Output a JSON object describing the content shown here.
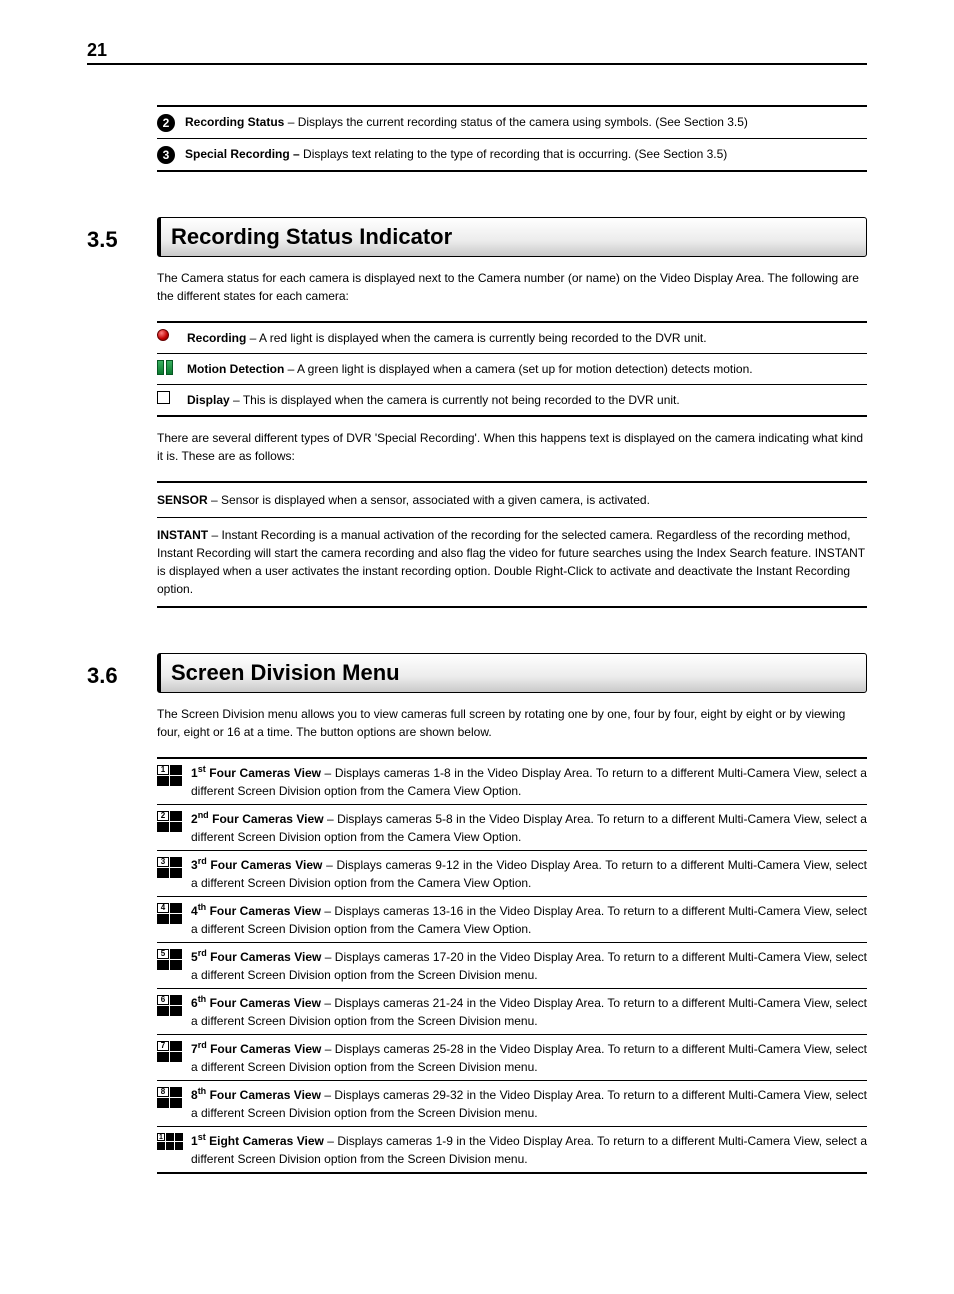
{
  "page_number": "21",
  "callouts": [
    {
      "num": "2",
      "title": "Recording Status",
      "rest": " – Displays the current recording status of the camera using symbols. (See Section 3.5)"
    },
    {
      "num": "3",
      "title": "Special Recording –",
      "rest": " Displays text relating to the type of recording that is occurring. (See Section 3.5)"
    }
  ],
  "sec35": {
    "num": "3.5",
    "title": "Recording Status Indicator",
    "intro": "The Camera status for each camera is displayed next to the Camera number (or name) on the Video Display Area. The following are the different states for each camera:",
    "statuses": [
      {
        "icon": "red-dot",
        "title": "Recording",
        "rest": " – A red light is displayed when the camera is currently being recorded to the DVR unit."
      },
      {
        "icon": "green-bars",
        "title": "Motion Detection",
        "rest": " – A green light is displayed when a camera (set up for motion detection) detects motion."
      },
      {
        "icon": "empty-sq",
        "title": "Display",
        "rest": " – This is displayed when the camera is currently not being recorded to the DVR unit."
      }
    ],
    "special_intro": "There are several different types of DVR 'Special Recording'. When this happens text is displayed on the camera indicating what kind it is. These are as follows:",
    "specials": [
      {
        "title": "SENSOR",
        "rest": " – Sensor is displayed when a sensor, associated with a given camera, is activated."
      },
      {
        "title": "INSTANT",
        "rest": " – Instant Recording is a manual activation of the recording for the selected camera. Regardless of the recording method, Instant Recording will start the camera recording and also flag the video for future searches using the Index Search feature. INSTANT is displayed when a user activates the instant recording option. Double Right-Click to activate and deactivate the Instant Recording option."
      }
    ]
  },
  "sec36": {
    "num": "3.6",
    "title": "Screen Division Menu",
    "intro": "The Screen Division menu allows you to view cameras full screen by rotating one by one, four by four, eight by eight or by viewing four, eight or 16 at a time. The button options are shown below.",
    "views": [
      {
        "iconType": "g4",
        "iconNum": "1",
        "ord": "1",
        "sup": "st",
        "name": " Four Cameras View",
        "rest": " – Displays cameras 1-8 in the Video Display Area. To return to a different Multi-Camera View, select a different Screen Division option from the Camera View Option."
      },
      {
        "iconType": "g4",
        "iconNum": "2",
        "ord": "2",
        "sup": "nd",
        "name": " Four Cameras View",
        "rest": " – Displays cameras 5-8 in the Video Display Area. To return to a different Multi-Camera View, select a different Screen Division option from the Camera View Option."
      },
      {
        "iconType": "g4",
        "iconNum": "3",
        "ord": "3",
        "sup": "rd",
        "name": " Four Cameras View",
        "rest": " – Displays cameras 9-12 in the Video Display Area. To return to a different Multi-Camera View, select a different Screen Division option from the Camera View Option."
      },
      {
        "iconType": "g4",
        "iconNum": "4",
        "ord": "4",
        "sup": "th",
        "name": " Four Cameras View",
        "rest": " – Displays cameras 13-16 in the Video Display Area. To return to a different Multi-Camera View, select a different Screen Division option from the Camera View Option."
      },
      {
        "iconType": "g4",
        "iconNum": "5",
        "ord": "5",
        "sup": "rd",
        "name": " Four Cameras View",
        "rest": " – Displays cameras 17-20 in the Video Display Area. To return to a different Multi-Camera View, select a different Screen Division option from the Screen Division menu."
      },
      {
        "iconType": "g4",
        "iconNum": "6",
        "ord": "6",
        "sup": "th",
        "name": " Four Cameras View",
        "rest": " – Displays cameras 21-24 in the Video Display Area. To return to a different Multi-Camera View, select a different Screen Division option from the Screen Division menu."
      },
      {
        "iconType": "g4",
        "iconNum": "7",
        "ord": "7",
        "sup": "rd",
        "name": " Four Cameras View",
        "rest": " – Displays cameras 25-28 in the Video Display Area. To return to a different Multi-Camera View, select a different Screen Division option from the Screen Division menu."
      },
      {
        "iconType": "g4",
        "iconNum": "8",
        "ord": "8",
        "sup": "th",
        "name": " Four Cameras View",
        "rest": " – Displays cameras 29-32 in the Video Display Area. To return to a different Multi-Camera View, select a different Screen Division option from the Screen Division menu."
      },
      {
        "iconType": "g8",
        "iconNum": "1",
        "ord": "1",
        "sup": "st",
        "name": " Eight Cameras View",
        "rest": " – Displays cameras 1-9 in the Video Display Area. To return to a different Multi-Camera View, select a different Screen Division option from the Screen Division menu."
      }
    ]
  }
}
